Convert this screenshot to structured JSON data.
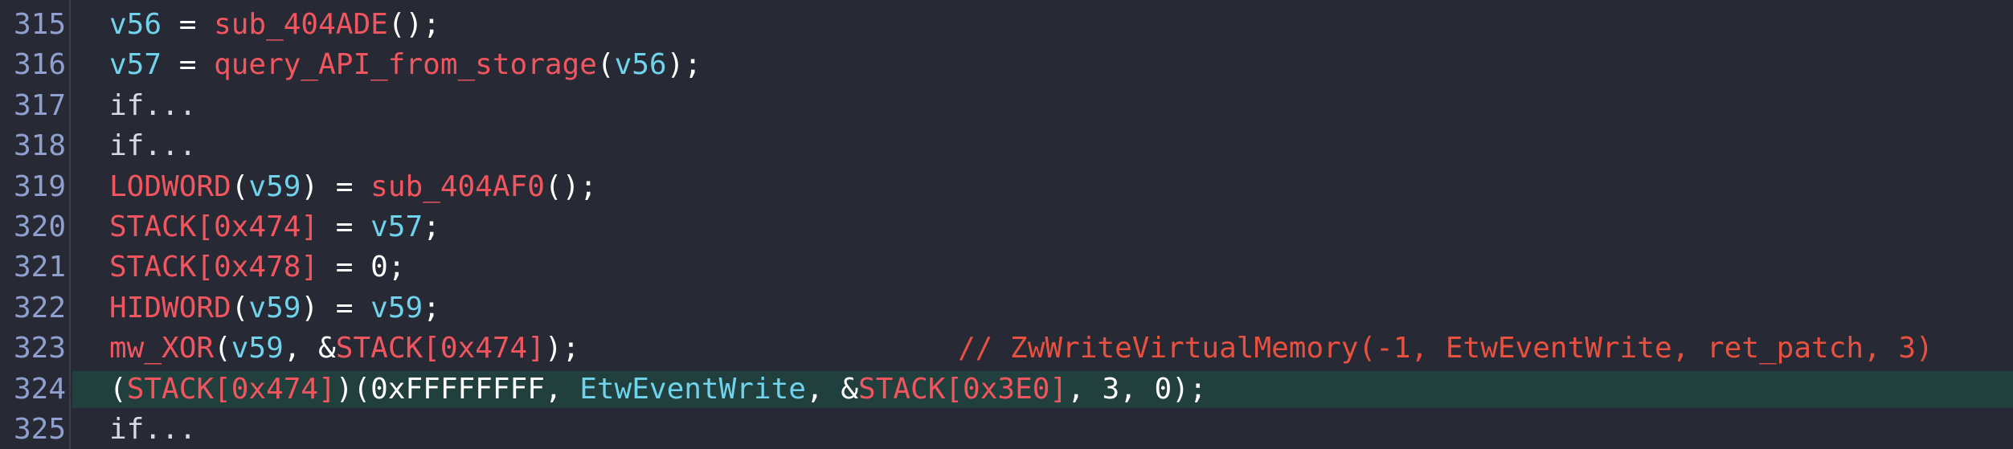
{
  "colors": {
    "background": "#272a35",
    "line_number": "#8fa0cf",
    "variable": "#6fd3ec",
    "function": "#f1555e",
    "comment": "#e8503f",
    "highlight": "#213f3c"
  },
  "lines": [
    {
      "num": "315",
      "tokens": [
        {
          "t": "var",
          "v": "v56"
        },
        {
          "t": "txt",
          "v": " = "
        },
        {
          "t": "fn",
          "v": "sub_404ADE"
        },
        {
          "t": "txt",
          "v": "();"
        }
      ]
    },
    {
      "num": "316",
      "tokens": [
        {
          "t": "var",
          "v": "v57"
        },
        {
          "t": "txt",
          "v": " = "
        },
        {
          "t": "fn",
          "v": "query_API_from_storage"
        },
        {
          "t": "txt",
          "v": "("
        },
        {
          "t": "var",
          "v": "v56"
        },
        {
          "t": "txt",
          "v": ");"
        }
      ]
    },
    {
      "num": "317",
      "tokens": [
        {
          "t": "kw",
          "v": "if..."
        }
      ]
    },
    {
      "num": "318",
      "tokens": [
        {
          "t": "kw",
          "v": "if..."
        }
      ]
    },
    {
      "num": "319",
      "tokens": [
        {
          "t": "fn",
          "v": "LODWORD"
        },
        {
          "t": "txt",
          "v": "("
        },
        {
          "t": "var",
          "v": "v59"
        },
        {
          "t": "txt",
          "v": ") = "
        },
        {
          "t": "fn",
          "v": "sub_404AF0"
        },
        {
          "t": "txt",
          "v": "();"
        }
      ]
    },
    {
      "num": "320",
      "tokens": [
        {
          "t": "fn",
          "v": "STACK[0x474]"
        },
        {
          "t": "txt",
          "v": " = "
        },
        {
          "t": "var",
          "v": "v57"
        },
        {
          "t": "txt",
          "v": ";"
        }
      ]
    },
    {
      "num": "321",
      "tokens": [
        {
          "t": "fn",
          "v": "STACK[0x478]"
        },
        {
          "t": "txt",
          "v": " = 0;"
        }
      ]
    },
    {
      "num": "322",
      "tokens": [
        {
          "t": "fn",
          "v": "HIDWORD"
        },
        {
          "t": "txt",
          "v": "("
        },
        {
          "t": "var",
          "v": "v59"
        },
        {
          "t": "txt",
          "v": ") = "
        },
        {
          "t": "var",
          "v": "v59"
        },
        {
          "t": "txt",
          "v": ";"
        }
      ]
    },
    {
      "num": "323",
      "tokens": [
        {
          "t": "fn",
          "v": "mw_XOR"
        },
        {
          "t": "txt",
          "v": "("
        },
        {
          "t": "var",
          "v": "v59"
        },
        {
          "t": "txt",
          "v": ", &"
        },
        {
          "t": "fn",
          "v": "STACK[0x474]"
        },
        {
          "t": "txt",
          "v": ");"
        }
      ],
      "comment": "// ZwWriteVirtualMemory(-1, EtwEventWrite, ret_patch, 3)"
    },
    {
      "num": "324",
      "highlighted": true,
      "tokens": [
        {
          "t": "txt",
          "v": "("
        },
        {
          "t": "fn",
          "v": "STACK[0x474]"
        },
        {
          "t": "txt",
          "v": ")(0xFFFFFFFF, "
        },
        {
          "t": "var",
          "v": "EtwEventWrite"
        },
        {
          "t": "txt",
          "v": ", &"
        },
        {
          "t": "fn",
          "v": "STACK[0x3E0]"
        },
        {
          "t": "txt",
          "v": ", 3, 0);"
        }
      ]
    },
    {
      "num": "325",
      "tokens": [
        {
          "t": "kw",
          "v": "if..."
        }
      ]
    }
  ]
}
